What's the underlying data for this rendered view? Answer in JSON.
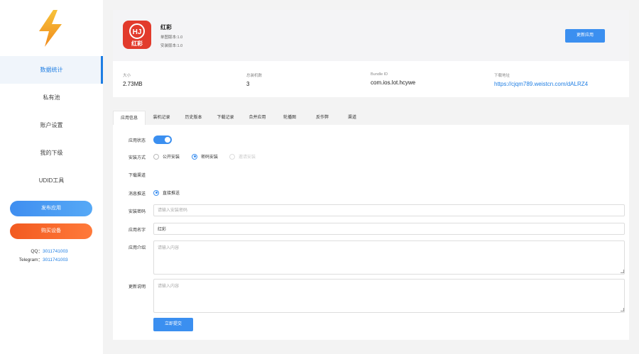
{
  "sidebar": {
    "logo_icon": "lightning-bolt-icon",
    "items": [
      {
        "label": "数据统计",
        "active": true
      },
      {
        "label": "私有池"
      },
      {
        "label": "账户设置"
      },
      {
        "label": "我的下级"
      },
      {
        "label": "UDID工具"
      }
    ],
    "publish_label": "发布应用",
    "buy_label": "购买设备",
    "qq_key": "QQ：",
    "qq_value": "3011741003",
    "telegram_key": "Telegram：",
    "telegram_value": "3011741003"
  },
  "app": {
    "icon_text": "红彩",
    "name": "红彩",
    "version_single": "单图版本:1.0",
    "version_install": "安装版本:1.0",
    "update_label": "更新应用"
  },
  "stats": [
    {
      "label": "大小",
      "value": "2.73MB"
    },
    {
      "label": "总装机数",
      "value": "3"
    },
    {
      "label": "Bundle ID",
      "value": "com.ios.lot.hcywe"
    },
    {
      "label": "下载地址",
      "value": "https://cjqm789.weistcn.com/dALRZ4"
    }
  ],
  "tabs": [
    "应用信息",
    "装机记录",
    "历史版本",
    "下载记录",
    "合并应用",
    "轮播图",
    "反作弊",
    "渠道"
  ],
  "form": {
    "status_label": "应用状态",
    "status_on": true,
    "install_label": "安装方式",
    "install_options": [
      "公开安装",
      "密码安装",
      "邀请安装"
    ],
    "channel_label": "下载渠道",
    "push_label": "消息推送",
    "push_option": "直接推送",
    "password_label": "安装密码",
    "password_placeholder": "请输入安装密码",
    "appname_label": "应用名字",
    "appname_value": "红彩",
    "intro_label": "应用介绍",
    "intro_placeholder": "请输入内容",
    "update_note_label": "更新说明",
    "update_note_placeholder": "请输入内容",
    "submit_label": "立即提交"
  },
  "colors": {
    "accent": "#3b8ff0",
    "buy": "#f25a20",
    "logo": "#f6a623"
  }
}
